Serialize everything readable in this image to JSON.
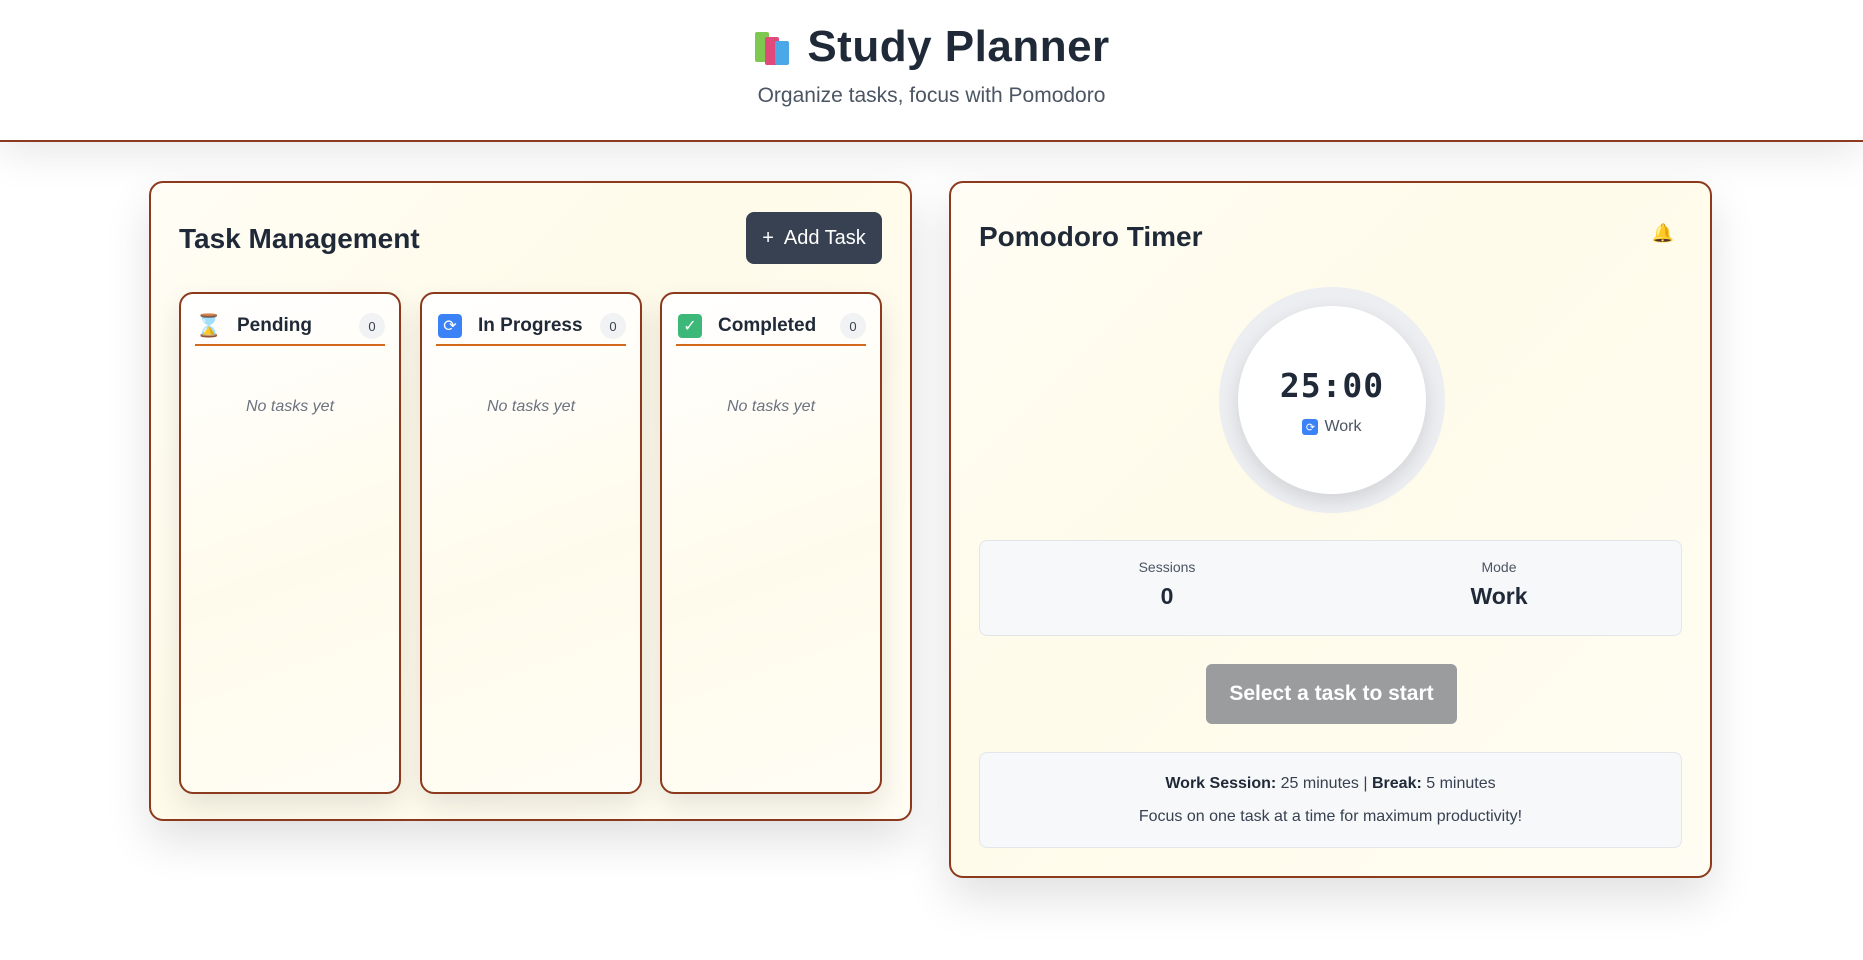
{
  "header": {
    "title": "Study Planner",
    "subtitle": "Organize tasks, focus with Pomodoro",
    "icon": "books-icon"
  },
  "tasks": {
    "title": "Task Management",
    "add_button": {
      "icon": "+",
      "label": "Add Task"
    },
    "columns": [
      {
        "label": "Pending",
        "count": "0",
        "icon": "hourglass-icon",
        "empty": "No tasks yet"
      },
      {
        "label": "In Progress",
        "count": "0",
        "icon": "refresh-icon",
        "empty": "No tasks yet"
      },
      {
        "label": "Completed",
        "count": "0",
        "icon": "check-icon",
        "empty": "No tasks yet"
      }
    ]
  },
  "timer": {
    "title": "Pomodoro Timer",
    "bell_icon": "bell-icon",
    "time": "25:00",
    "mode_label": "Work",
    "stats": {
      "sessions_label": "Sessions",
      "sessions_value": "0",
      "mode_label": "Mode",
      "mode_value": "Work"
    },
    "start_button": "Select a task to start",
    "info": {
      "work_label": "Work Session:",
      "work_value": "25 minutes",
      "separator": "|",
      "break_label": "Break:",
      "break_value": "5 minutes",
      "tip": "Focus on one task at a time for maximum productivity!"
    }
  },
  "colors": {
    "accent_border": "#8b3a1e",
    "column_divider": "#d4691e",
    "primary_button": "#374151",
    "disabled_button": "#9a9c9e"
  }
}
